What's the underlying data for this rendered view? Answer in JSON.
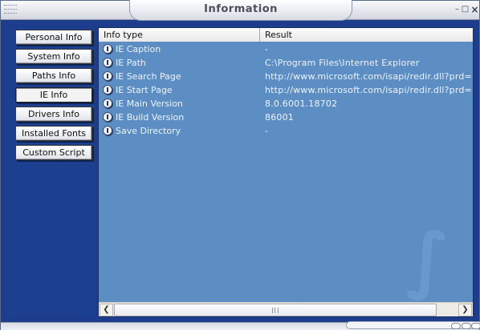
{
  "window": {
    "title": "Information",
    "minimize_icon": "minimize-icon",
    "maximize_icon": "maximize-icon",
    "close_icon": "close-icon"
  },
  "nav": {
    "items": [
      {
        "label": "Personal Info",
        "active": false
      },
      {
        "label": "System Info",
        "active": false
      },
      {
        "label": "Paths Info",
        "active": false
      },
      {
        "label": "IE Info",
        "active": true
      },
      {
        "label": "Drivers Info",
        "active": false
      },
      {
        "label": "Installed Fonts",
        "active": false
      },
      {
        "label": "Custom Script",
        "active": false
      }
    ]
  },
  "table": {
    "columns": [
      "Info type",
      "Result"
    ],
    "row_icon": "info-icon",
    "rows": [
      {
        "type": "IE Caption",
        "result": "-"
      },
      {
        "type": "IE Path",
        "result": "C:\\Program Files\\Internet Explorer"
      },
      {
        "type": "IE Search Page",
        "result": "http://www.microsoft.com/isapi/redir.dll?prd=ie"
      },
      {
        "type": "IE Start Page",
        "result": "http://www.microsoft.com/isapi/redir.dll?prd=ie"
      },
      {
        "type": "IE Main Version",
        "result": "8.0.6001.18702"
      },
      {
        "type": "IE Build Version",
        "result": "86001"
      },
      {
        "type": "Save Directory",
        "result": "-"
      }
    ]
  },
  "scrollbar": {
    "left_icon": "scroll-left-icon",
    "right_icon": "scroll-right-icon"
  },
  "colors": {
    "frame": "#1e3c8c",
    "list_background": "#5c8ec4",
    "row_text": "#eef3fa"
  }
}
